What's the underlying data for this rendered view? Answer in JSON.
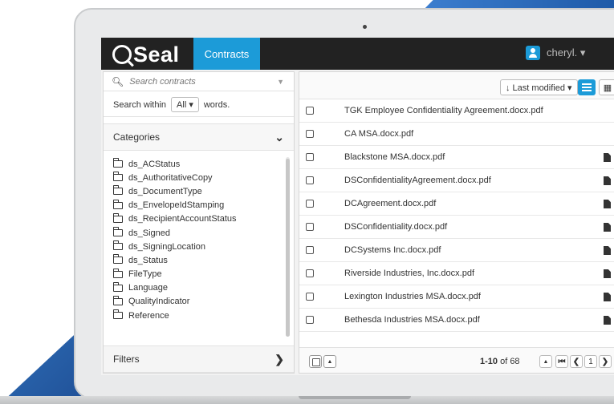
{
  "header": {
    "logo_text": "Seal",
    "nav_tab": "Contracts",
    "user_name": "cheryl. ▾"
  },
  "sidebar": {
    "search_placeholder": "Search contracts",
    "search_within_prefix": "Search within",
    "search_within_value": "All ▾",
    "search_within_suffix": "words.",
    "categories_label": "Categories",
    "categories": [
      "ds_ACStatus",
      "ds_AuthoritativeCopy",
      "ds_DocumentType",
      "ds_EnvelopeIdStamping",
      "ds_RecipientAccountStatus",
      "ds_Signed",
      "ds_SigningLocation",
      "ds_Status",
      "FileType",
      "Language",
      "QualityIndicator",
      "Reference"
    ],
    "filters_label": "Filters"
  },
  "main": {
    "sort_label": "↓ Last modified ▾",
    "documents": [
      "TGK Employee Confidentiality Agreement.docx.pdf",
      "CA MSA.docx.pdf",
      "Blackstone MSA.docx.pdf",
      "DSConfidentialityAgreement.docx.pdf",
      "DCAgreement.docx.pdf",
      "DSConfidentiality.docx.pdf",
      "DCSystems Inc.docx.pdf",
      "Riverside Industries, Inc.docx.pdf",
      "Lexington Industries MSA.docx.pdf",
      "Bethesda Industries MSA.docx.pdf"
    ],
    "pagination": {
      "range": "1-10",
      "of_total": " of 68",
      "current_page": "1"
    }
  },
  "colors": {
    "accent": "#1c9bd8",
    "topbar": "#222222"
  }
}
